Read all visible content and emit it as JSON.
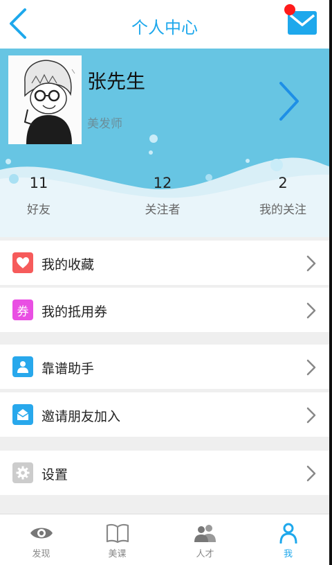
{
  "header": {
    "title": "个人中心"
  },
  "profile": {
    "name": "张先生",
    "job": "美发师",
    "stats": [
      {
        "value": "11",
        "label": "好友"
      },
      {
        "value": "12",
        "label": "关注者"
      },
      {
        "value": "2",
        "label": "我的关注"
      }
    ]
  },
  "menu": [
    {
      "label": "我的收藏",
      "icon": "heart-icon",
      "color": "#f65b5b"
    },
    {
      "label": "我的抵用券",
      "icon": "coupon-icon",
      "color": "#e94fe3",
      "glyph": "券"
    },
    {
      "label": "靠谱助手",
      "icon": "person-icon",
      "color": "#28a8ec"
    },
    {
      "label": "邀请朋友加入",
      "icon": "envelope-icon",
      "color": "#28a8ec"
    },
    {
      "label": "设置",
      "icon": "gear-icon",
      "color": "#cccccc"
    }
  ],
  "nav": [
    {
      "label": "发现",
      "icon": "eye-icon"
    },
    {
      "label": "美课",
      "icon": "book-icon"
    },
    {
      "label": "人才",
      "icon": "people-icon"
    },
    {
      "label": "我",
      "icon": "user-icon",
      "active": true
    }
  ],
  "colors": {
    "accent": "#1ea8ec",
    "banner": "#67c5e3",
    "badge": "#ff1a1a"
  }
}
